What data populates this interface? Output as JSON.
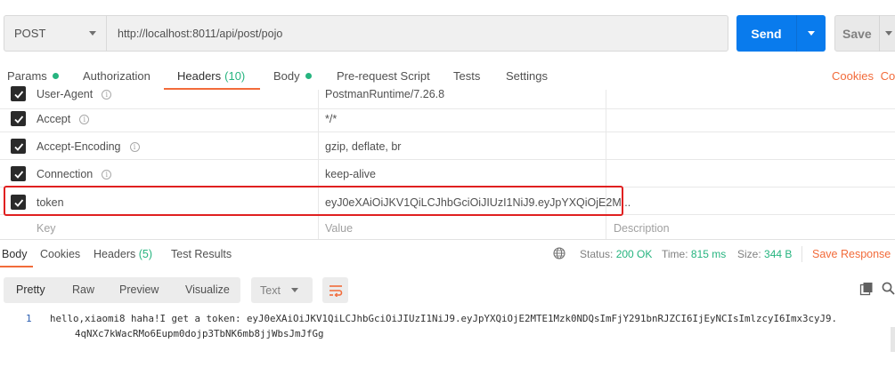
{
  "request": {
    "method": "POST",
    "url": "http://localhost:8011/api/post/pojo",
    "send_label": "Send",
    "save_label": "Save"
  },
  "request_tabs": {
    "params": "Params",
    "authorization": "Authorization",
    "headers": "Headers",
    "headers_count": "(10)",
    "body": "Body",
    "prerequest": "Pre-request Script",
    "tests": "Tests",
    "settings": "Settings",
    "cookies": "Cookies",
    "cookies_trunc": "Co"
  },
  "headers": [
    {
      "key": "User-Agent",
      "value": "PostmanRuntime/7.26.8",
      "info": "i"
    },
    {
      "key": "Accept",
      "value": "*/*",
      "info": "i"
    },
    {
      "key": "Accept-Encoding",
      "value": "gzip, deflate, br",
      "info": "i"
    },
    {
      "key": "Connection",
      "value": "keep-alive",
      "info": "i"
    },
    {
      "key": "token",
      "value": "eyJ0eXAiOiJKV1QiLCJhbGciOiJIUzI1NiJ9.eyJpYXQiOjE2M..."
    }
  ],
  "header_placeholders": {
    "key": "Key",
    "value": "Value",
    "description": "Description"
  },
  "response_tabs": {
    "body": "Body",
    "cookies": "Cookies",
    "headers": "Headers",
    "headers_count": "(5)",
    "test_results": "Test Results"
  },
  "response_status": {
    "status_label": "Status:",
    "status_value": "200 OK",
    "time_label": "Time:",
    "time_value": "815 ms",
    "size_label": "Size:",
    "size_value": "344 B",
    "save_response": "Save Response"
  },
  "body_toolbar": {
    "pretty": "Pretty",
    "raw": "Raw",
    "preview": "Preview",
    "visualize": "Visualize",
    "format": "Text"
  },
  "response_body": {
    "line_number": "1",
    "line1": "hello,xiaomi8 haha!I get a token: eyJ0eXAiOiJKV1QiLCJhbGciOiJIUzI1NiJ9.eyJpYXQiOjE2MTE1Mzk0NDQsImFjY291bnRJZCI6IjEyNCIsImlzcyI6Imx3cyJ9.",
    "line2": "4qNXc7kWacRMo6Eupm0dojp3TbNK6mb8jjWbsJmJfGg"
  },
  "colors": {
    "accent": "#f26b3a",
    "send": "#097bed",
    "success": "#26b47f",
    "highlight": "#e02020"
  }
}
